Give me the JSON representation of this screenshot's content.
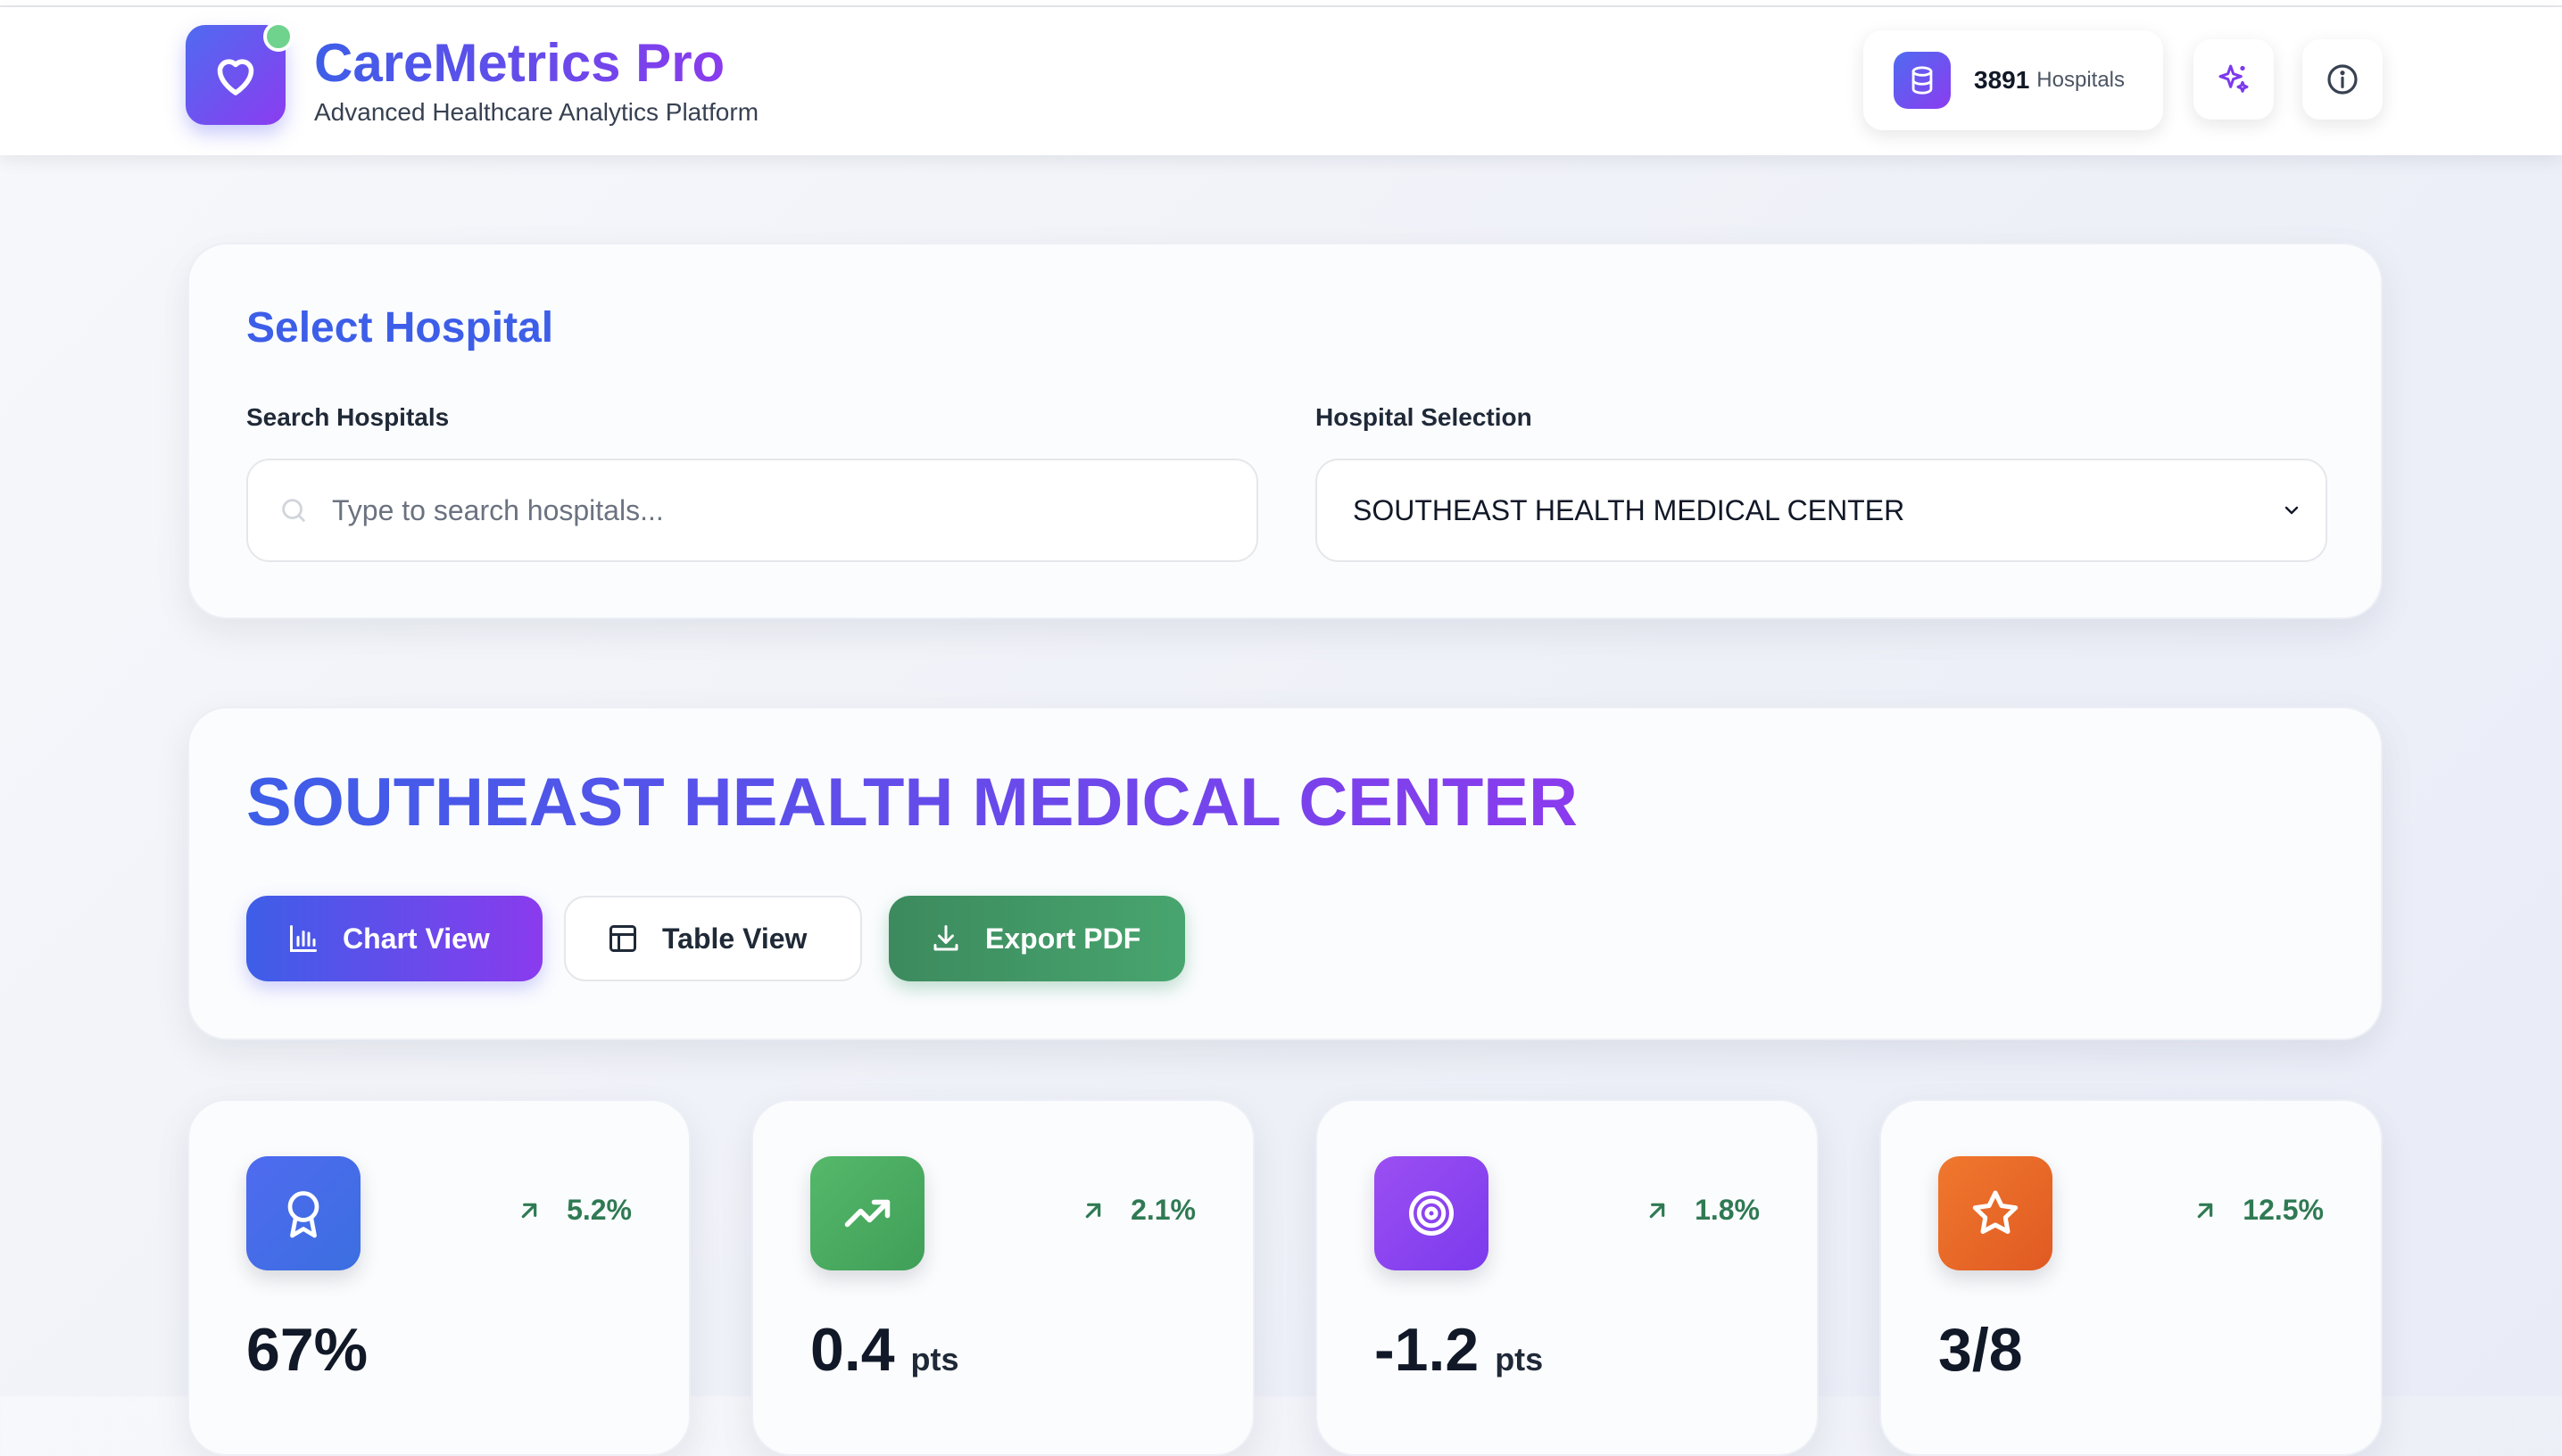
{
  "header": {
    "app_title": "CareMetrics Pro",
    "app_subtitle": "Advanced Healthcare Analytics Platform",
    "hospital_count": "3891",
    "hospital_count_unit": "Hospitals",
    "icons": [
      "heart-icon",
      "database-icon",
      "sparkles-icon",
      "info-icon"
    ]
  },
  "select_card": {
    "title": "Select Hospital",
    "search_label": "Search Hospitals",
    "search_placeholder": "Type to search hospitals...",
    "search_value": "",
    "selection_label": "Hospital Selection",
    "selected_hospital": "SOUTHEAST HEALTH MEDICAL CENTER"
  },
  "hospital_card": {
    "name": "SOUTHEAST HEALTH MEDICAL CENTER",
    "buttons": {
      "chart_view": "Chart View",
      "table_view": "Table View",
      "export_pdf": "Export PDF"
    }
  },
  "metrics": [
    {
      "icon": "award-icon",
      "color": "#4f6bf0",
      "trend": "5.2%",
      "value": "67%",
      "unit": ""
    },
    {
      "icon": "trending-up-icon",
      "color": "#4caf63",
      "trend": "2.1%",
      "value": "0.4",
      "unit": "pts"
    },
    {
      "icon": "target-icon",
      "color": "#8b3cf0",
      "trend": "1.8%",
      "value": "-1.2",
      "unit": "pts"
    },
    {
      "icon": "star-icon",
      "color": "#ea6a2a",
      "trend": "12.5%",
      "value": "3/8",
      "unit": ""
    }
  ],
  "colors": {
    "brand_start": "#3d5ee8",
    "brand_end": "#8a3bed",
    "trend_positive": "#2f7a53",
    "online_dot": "#6fd38e"
  }
}
